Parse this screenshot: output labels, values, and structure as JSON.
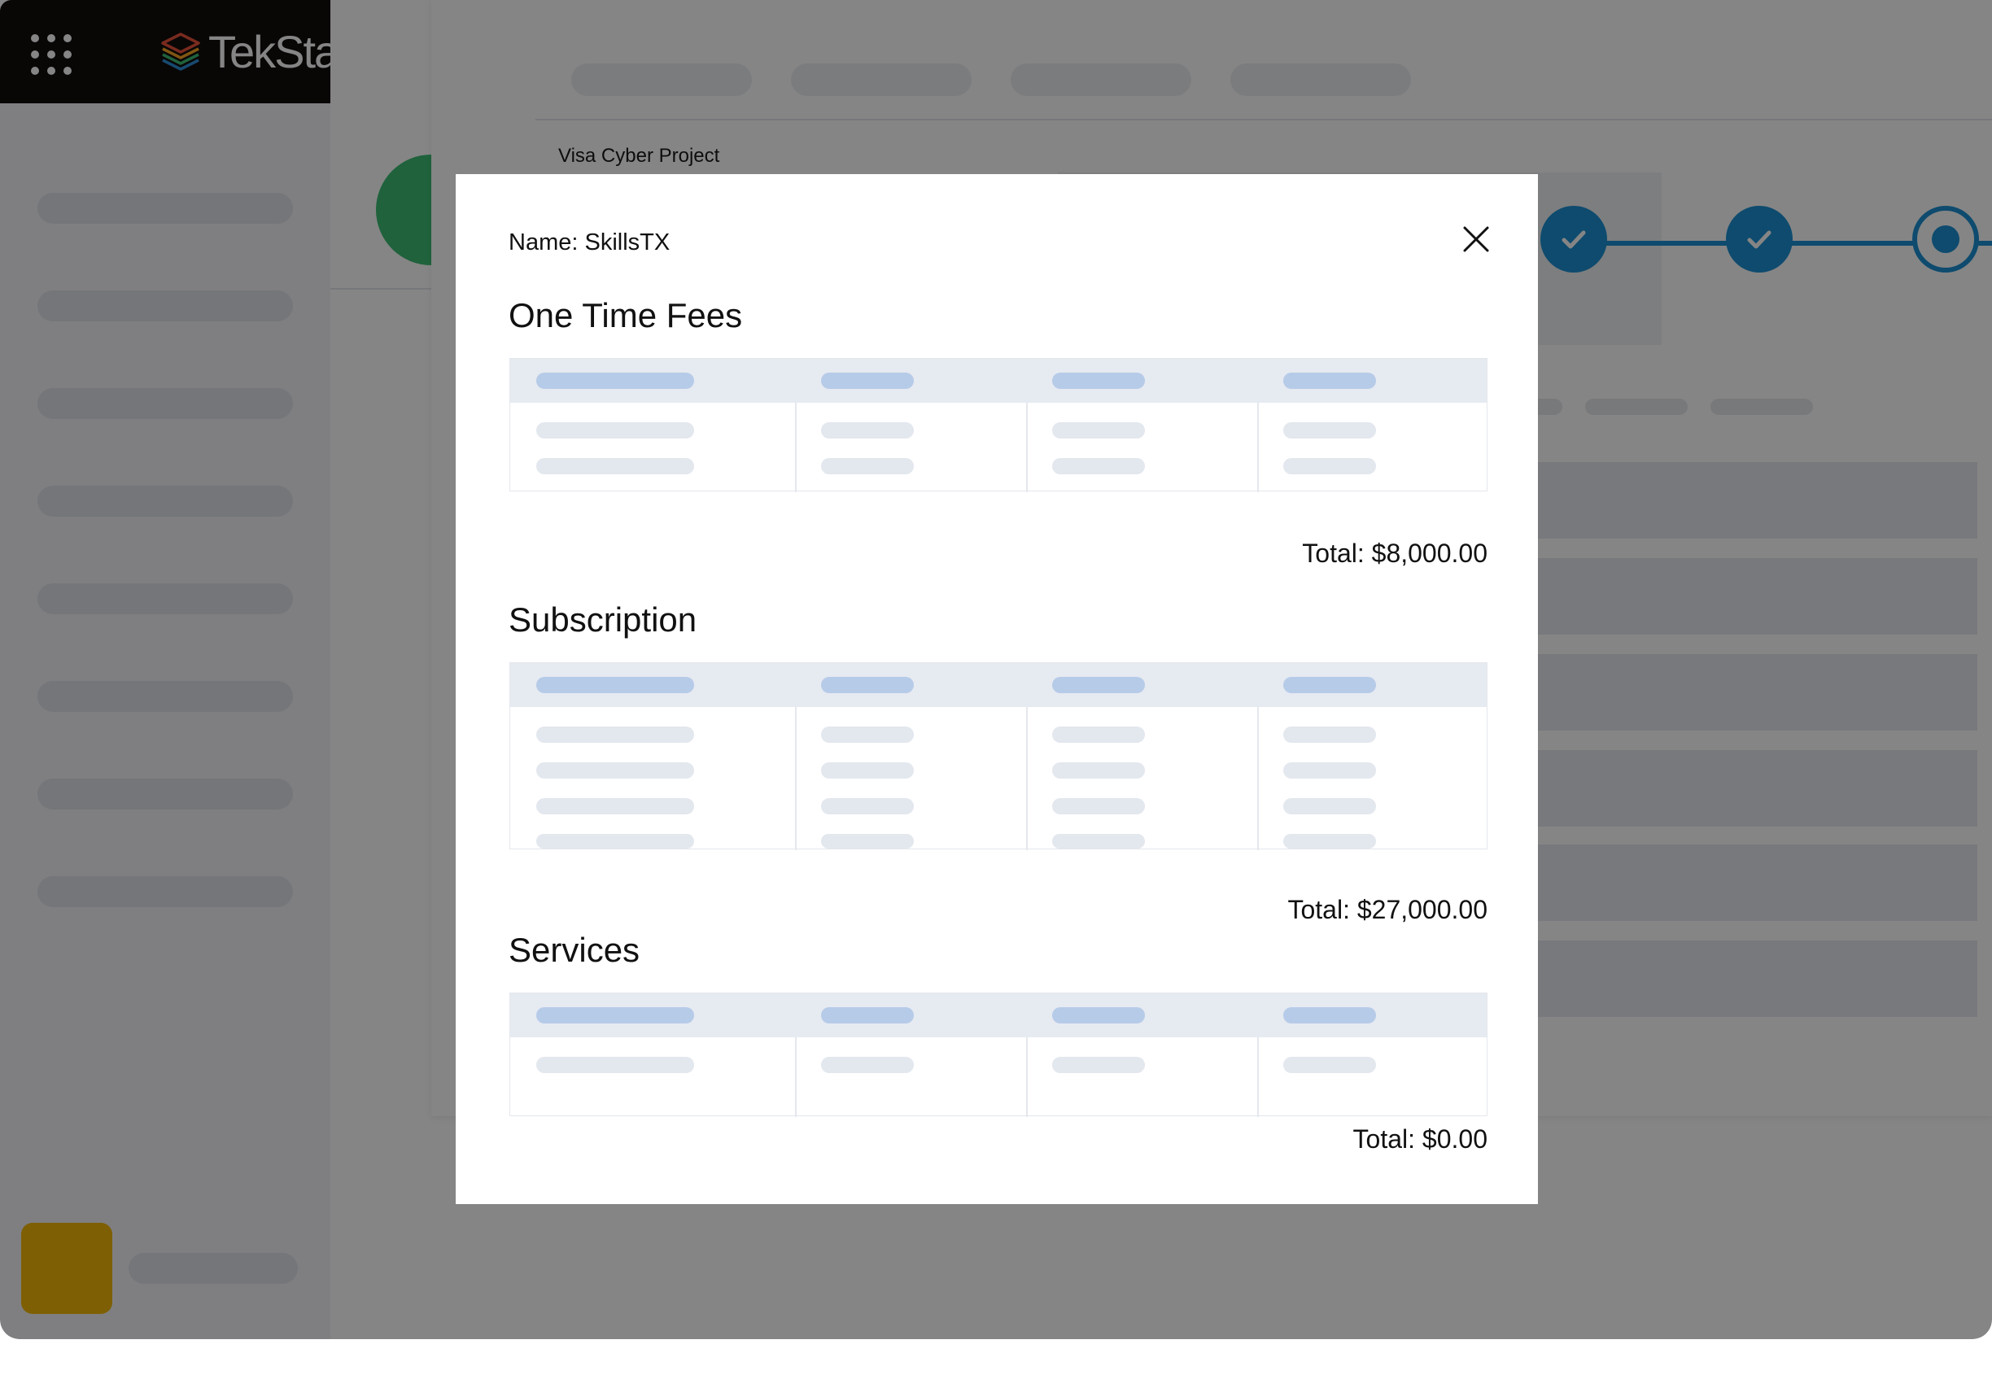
{
  "header": {
    "apps_icon": "grid-dots-icon",
    "logo_text": "TekStack",
    "logo_icon": "layered-stack-icon"
  },
  "project": {
    "name": "Visa Cyber Project"
  },
  "progress": {
    "steps": [
      {
        "status": "complete",
        "icon": "check-icon"
      },
      {
        "status": "complete",
        "icon": "check-icon"
      },
      {
        "status": "current",
        "icon": "dot-icon"
      }
    ]
  },
  "modal": {
    "name_line": "Name: SkillsTX",
    "close_icon": "close-icon",
    "sections": [
      {
        "title": "One Time Fees",
        "total": "Total: $8,000.00",
        "columns": 4,
        "rows": 2
      },
      {
        "title": "Subscription",
        "total": "Total: $27,000.00",
        "columns": 4,
        "rows": 4
      },
      {
        "title": "Services",
        "total": "Total: $0.00",
        "columns": 4,
        "rows": 1
      }
    ]
  },
  "colors": {
    "topbar": "#120c0c",
    "step_accent": "#1b90d4",
    "status_green": "#3dbd73",
    "avatar": "#f2b707",
    "skeleton_header": "#b6cbe8",
    "skeleton_cell": "#e3e7ee"
  }
}
